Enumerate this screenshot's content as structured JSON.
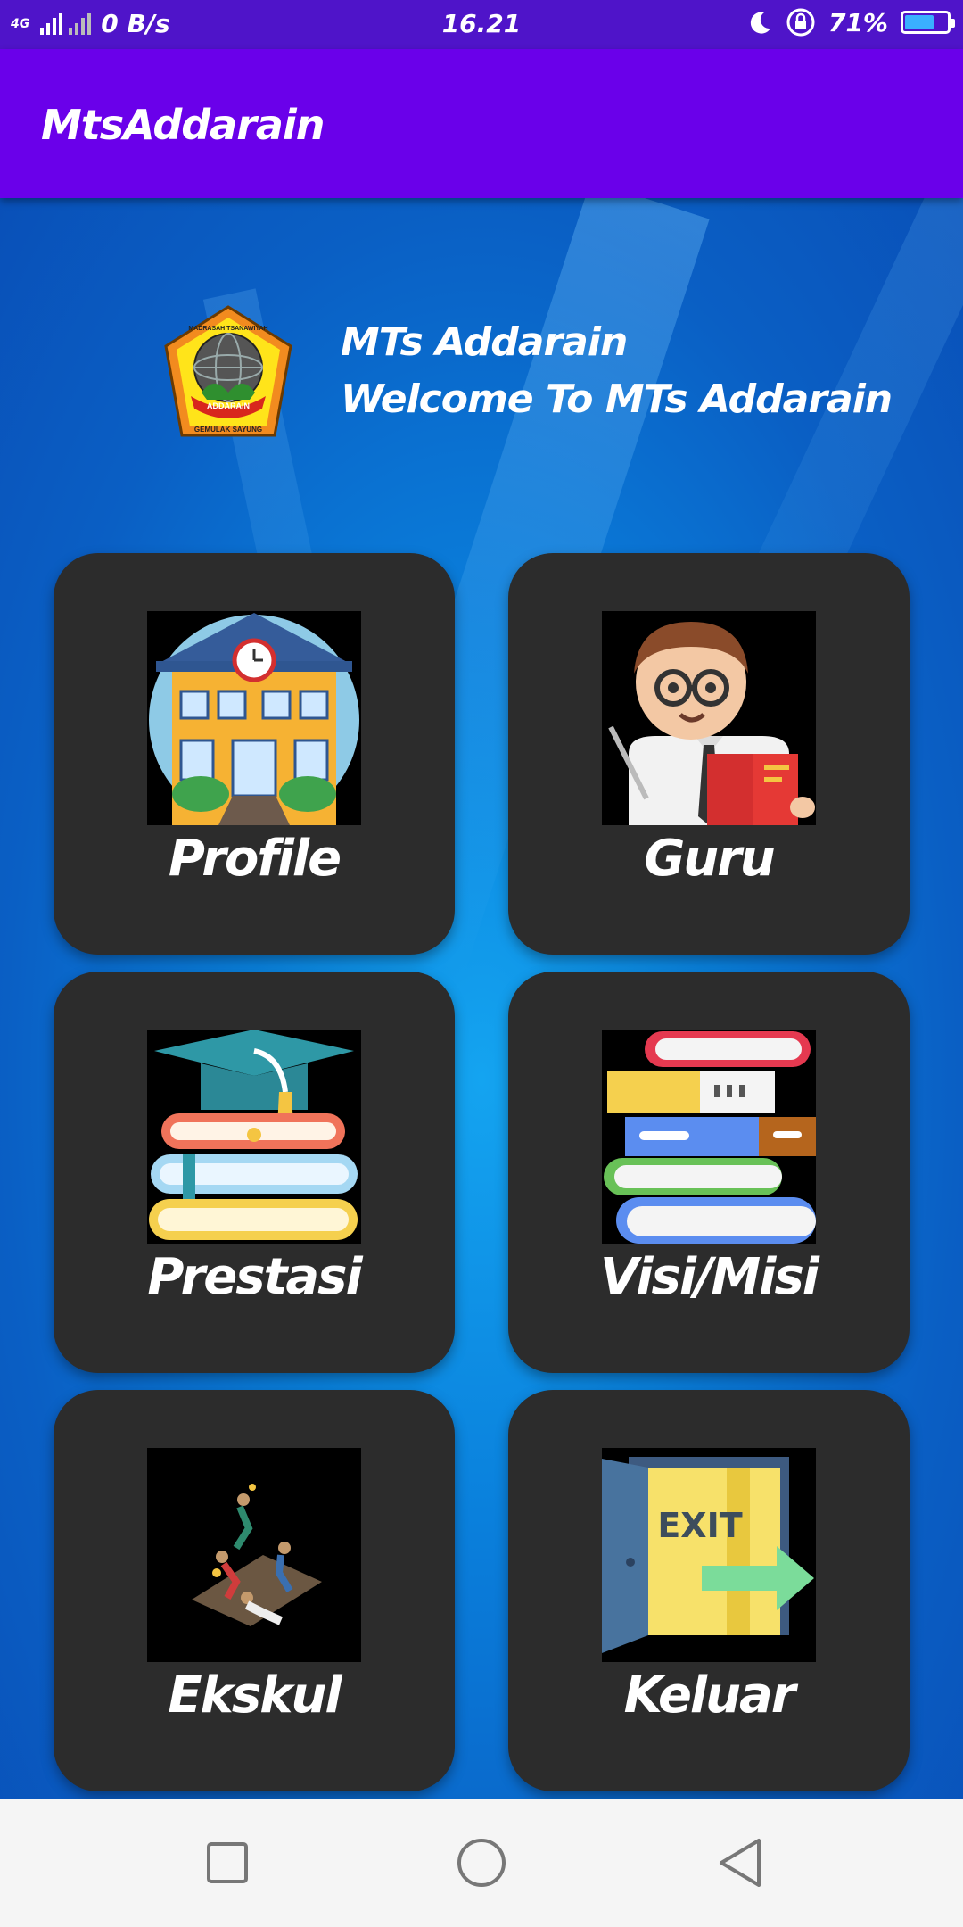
{
  "status": {
    "network": "4G",
    "speed": "0 B/s",
    "time": "16.21",
    "battery": "71%",
    "battery_level": 0.71,
    "icons": [
      "signal-icon",
      "moon-icon",
      "rotation-lock-icon",
      "battery-icon"
    ]
  },
  "appbar": {
    "title": "MtsAddarain"
  },
  "header": {
    "line1": "MTs Addarain",
    "line2": "Welcome To MTs Addarain",
    "logo_text_top": "MADRASAH TSANAWIYAH",
    "logo_text_ribbon": "ADDARAIN",
    "logo_text_bottom": "GEMULAK SAYUNG"
  },
  "menu": {
    "profile": "Profile",
    "guru": "Guru",
    "prestasi": "Prestasi",
    "visimisi": "Visi/Misi",
    "ekskul": "Ekskul",
    "keluar": "Keluar",
    "exit_sign": "EXIT"
  },
  "nav": {
    "icons": [
      "recent-apps-icon",
      "home-icon",
      "back-icon"
    ]
  },
  "colors": {
    "statusbar": "#4f14c9",
    "appbar": "#6a00ea",
    "card": "#2c2c2c",
    "background": "#0a80dc"
  }
}
